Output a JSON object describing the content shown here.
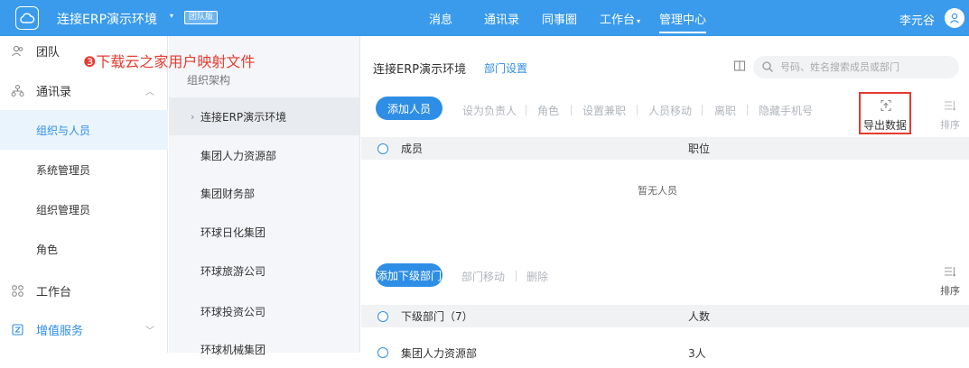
{
  "topbar": {
    "org_name": "连接ERP演示环境",
    "edition_badge": "团队版",
    "nav": [
      {
        "label": "消息"
      },
      {
        "label": "通讯录"
      },
      {
        "label": "同事圈"
      },
      {
        "label": "工作台"
      },
      {
        "label": "管理中心"
      }
    ],
    "user_name": "李元谷",
    "accent": "#3a9bec"
  },
  "annotation": "❸下载云之家用户映射文件",
  "sidebar": {
    "items": [
      {
        "label": "团队",
        "icon": "team-icon"
      },
      {
        "label": "通讯录",
        "icon": "contacts-icon"
      },
      {
        "label": "组织与人员"
      },
      {
        "label": "系统管理员"
      },
      {
        "label": "组织管理员"
      },
      {
        "label": "角色"
      },
      {
        "label": "工作台",
        "icon": "workbench-icon"
      },
      {
        "label": "增值服务",
        "icon": "value-service-icon"
      }
    ]
  },
  "dept_panel": {
    "header": "组织架构",
    "items": [
      "连接ERP演示环境",
      "集团人力资源部",
      "集团财务部",
      "环球日化集团",
      "环球旅游公司",
      "环球投资公司",
      "环球机械集团"
    ]
  },
  "main": {
    "breadcrumb_org": "连接ERP演示环境",
    "dept_settings": "部门设置",
    "search_placeholder": "号码、姓名搜索成员或部门",
    "add_member": "添加人员",
    "toolbar_actions": [
      "设为负责人",
      "角色",
      "设置兼职",
      "人员移动",
      "离职",
      "隐藏手机号"
    ],
    "export": "导出数据",
    "sort": "排序",
    "member_columns": [
      "成员",
      "职位"
    ],
    "empty": "暂无人员",
    "add_sub_dept": "添加下级部门",
    "sub_actions": [
      "部门移动",
      "删除"
    ],
    "sub_columns": [
      "下级部门（7）",
      "人数"
    ],
    "first_sub_row": {
      "name": "集团人力资源部",
      "count": "3人"
    }
  }
}
